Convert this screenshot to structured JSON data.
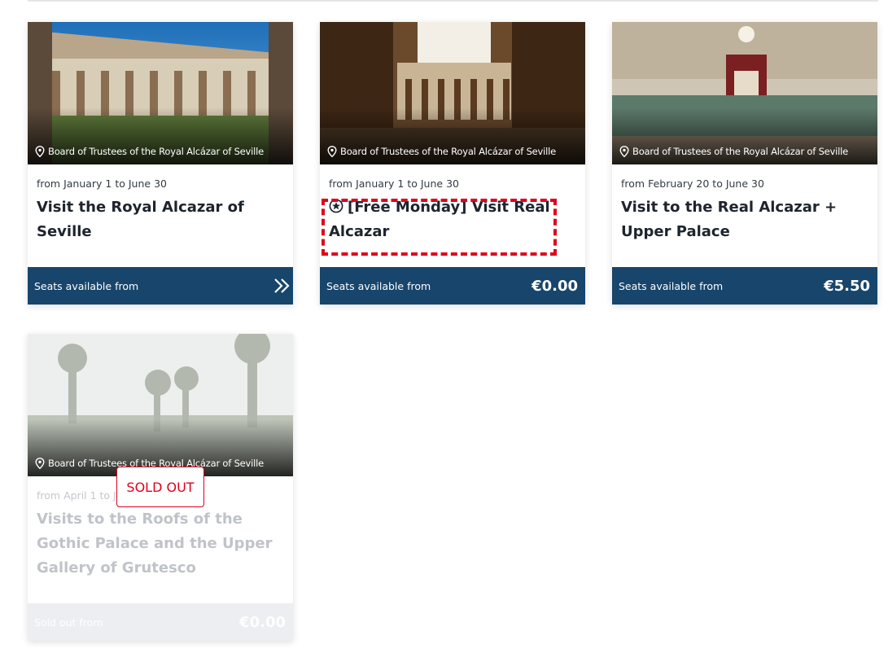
{
  "cards": [
    {
      "venue": "Board of Trustees of the Royal Alcázar of Seville",
      "dates": "from January 1 to June 30",
      "title": "Visit the Royal Alcazar of Seville",
      "footer_label": "Seats available from",
      "price": "",
      "has_chevron": true
    },
    {
      "venue": "Board of Trustees of the Royal Alcázar of Seville",
      "dates": "from January 1 to June 30",
      "title_icon": "star-circle-icon",
      "title": "[Free Monday] Visit Real Alcazar",
      "footer_label": "Seats available from",
      "price": "€0.00"
    },
    {
      "venue": "Board of Trustees of the Royal Alcázar of Seville",
      "dates": "from February 20 to June 30",
      "title": "Visit to the Real Alcazar + Upper Palace",
      "footer_label": "Seats available from",
      "price": "€5.50"
    },
    {
      "venue": "Board of Trustees of the Royal Alcázar of Seville",
      "dates": "from April 1 to J",
      "title": "Visits to the Roofs of the Gothic Palace and the Upper Gallery of Grutesco",
      "footer_label": "Sold out from",
      "price": "€0.00",
      "badge": "SOLD OUT"
    }
  ],
  "colors": {
    "footer_blue": "#17456b",
    "highlight_red": "#e0001b",
    "soldout_footer": "#eceef1"
  }
}
